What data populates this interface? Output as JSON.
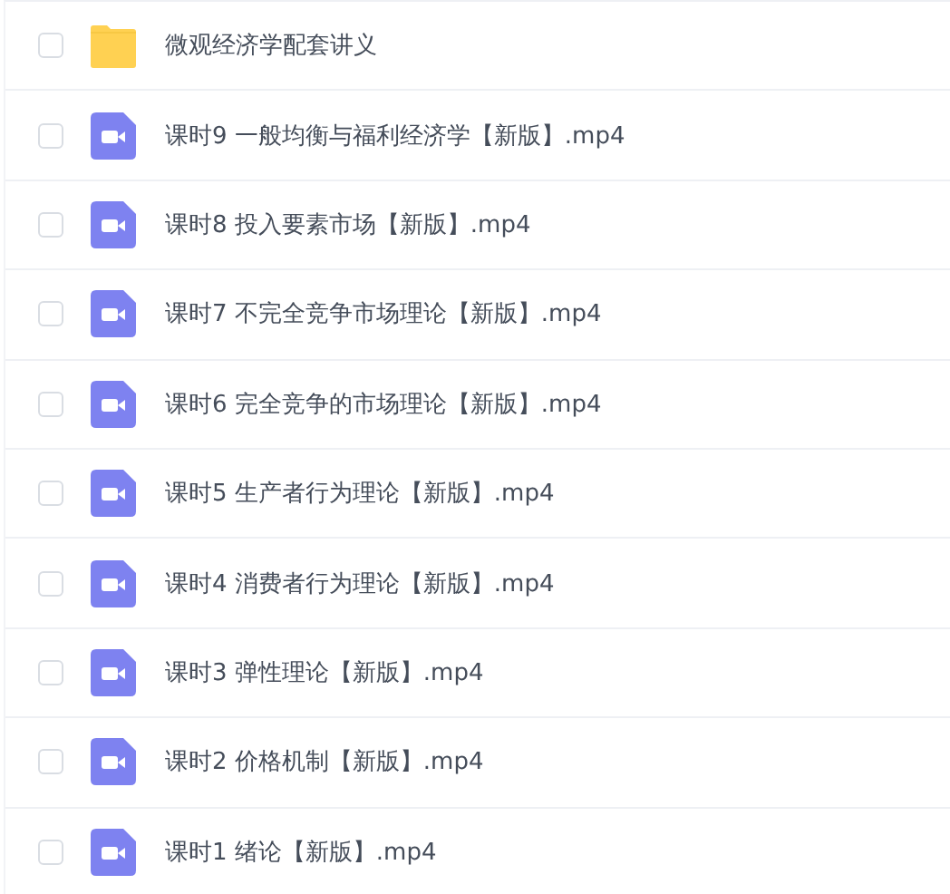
{
  "files": [
    {
      "kind": "folder",
      "name": "微观经济学配套讲义",
      "checked": false
    },
    {
      "kind": "video",
      "name": "课时9 一般均衡与福利经济学【新版】.mp4",
      "checked": false
    },
    {
      "kind": "video",
      "name": "课时8 投入要素市场【新版】.mp4",
      "checked": false
    },
    {
      "kind": "video",
      "name": "课时7 不完全竞争市场理论【新版】.mp4",
      "checked": false
    },
    {
      "kind": "video",
      "name": "课时6 完全竞争的市场理论【新版】.mp4",
      "checked": false
    },
    {
      "kind": "video",
      "name": "课时5 生产者行为理论【新版】.mp4",
      "checked": false
    },
    {
      "kind": "video",
      "name": "课时4 消费者行为理论【新版】.mp4",
      "checked": false
    },
    {
      "kind": "video",
      "name": "课时3 弹性理论【新版】.mp4",
      "checked": false
    },
    {
      "kind": "video",
      "name": "课时2 价格机制【新版】.mp4",
      "checked": false
    },
    {
      "kind": "video",
      "name": "课时1 绪论【新版】.mp4",
      "checked": false
    }
  ]
}
